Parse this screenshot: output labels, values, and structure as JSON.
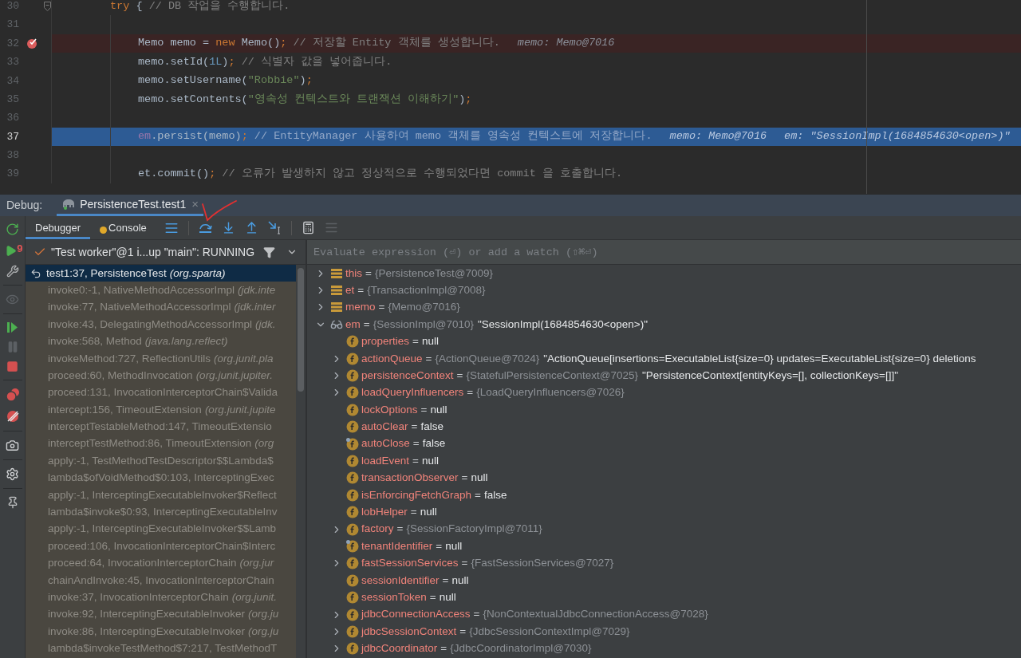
{
  "editor": {
    "lines": [
      {
        "number": "30",
        "nested": false,
        "breakpoint": false,
        "current": false,
        "fold": true,
        "segments": [
          {
            "kind": "keyword",
            "text": "try"
          },
          {
            "kind": "plain",
            "text": " { "
          },
          {
            "kind": "comment",
            "text": "// DB 작업을 수행합니다."
          }
        ]
      },
      {
        "number": "31",
        "nested": true,
        "breakpoint": false,
        "current": false,
        "fold": false
      },
      {
        "number": "32",
        "nested": true,
        "breakpoint": true,
        "current": false,
        "fold": false,
        "segments": [
          {
            "kind": "plain",
            "text": "Memo memo = "
          },
          {
            "kind": "keyword",
            "text": "new"
          },
          {
            "kind": "plain",
            "text": " Memo()"
          },
          {
            "kind": "keyword",
            "text": ";"
          },
          {
            "kind": "comment",
            "text": " // 저장할 Entity 객체를 생성합니다."
          },
          {
            "kind": "hint",
            "text": "memo: Memo@7016"
          }
        ]
      },
      {
        "number": "33",
        "nested": true,
        "breakpoint": false,
        "current": false,
        "fold": false,
        "segments": [
          {
            "kind": "plain",
            "text": "memo.setId("
          },
          {
            "kind": "number",
            "text": "1L"
          },
          {
            "kind": "plain",
            "text": ")"
          },
          {
            "kind": "keyword",
            "text": ";"
          },
          {
            "kind": "comment",
            "text": " // 식별자 값을 넣어줍니다."
          }
        ]
      },
      {
        "number": "34",
        "nested": true,
        "breakpoint": false,
        "current": false,
        "fold": false,
        "segments": [
          {
            "kind": "plain",
            "text": "memo.setUsername("
          },
          {
            "kind": "string",
            "text": "\"Robbie\""
          },
          {
            "kind": "plain",
            "text": ")"
          },
          {
            "kind": "keyword",
            "text": ";"
          }
        ]
      },
      {
        "number": "35",
        "nested": true,
        "breakpoint": false,
        "current": false,
        "fold": false,
        "segments": [
          {
            "kind": "plain",
            "text": "memo.setContents("
          },
          {
            "kind": "string",
            "text": "\"영속성 컨텍스트와 트랜잭션 이해하기\""
          },
          {
            "kind": "plain",
            "text": ")"
          },
          {
            "kind": "keyword",
            "text": ";"
          }
        ]
      },
      {
        "number": "36",
        "nested": true,
        "breakpoint": false,
        "current": false,
        "fold": false
      },
      {
        "number": "37",
        "nested": true,
        "breakpoint": false,
        "current": true,
        "fold": false,
        "segments": [
          {
            "kind": "field",
            "text": "em"
          },
          {
            "kind": "plain",
            "text": ".persist(memo)"
          },
          {
            "kind": "keyword",
            "text": ";"
          },
          {
            "kind": "comment",
            "text": " // EntityManager 사용하여 memo 객체를 영속성 컨텍스트에 저장합니다."
          },
          {
            "kind": "hint",
            "text": "memo: Memo@7016"
          },
          {
            "kind": "hint",
            "text": "em: \"SessionImpl(1684854630<open>)\""
          }
        ]
      },
      {
        "number": "38",
        "nested": true,
        "breakpoint": false,
        "current": false,
        "fold": false
      },
      {
        "number": "39",
        "nested": true,
        "breakpoint": false,
        "current": false,
        "fold": false,
        "segments": [
          {
            "kind": "plain",
            "text": "et.commit()"
          },
          {
            "kind": "keyword",
            "text": ";"
          },
          {
            "kind": "comment",
            "text": " // 오류가 발생하지 않고 정상적으로 수행되었다면 commit 을 호출합니다."
          }
        ]
      }
    ]
  },
  "debug": {
    "label": "Debug:",
    "tab": {
      "title": "PersistenceTest.test1",
      "close": "×"
    },
    "subtabs": [
      {
        "label": "Debugger",
        "selected": true
      },
      {
        "label": "Console",
        "selected": false
      }
    ],
    "breakpoint_count": "9",
    "thread": "\"Test worker\"@1 i...up \"main\": RUNNING",
    "frames": [
      {
        "method": "test1:37, PersistenceTest",
        "package": "(org.sparta)",
        "selected": true
      },
      {
        "method": "invoke0:-1, NativeMethodAccessorImpl",
        "package": "(jdk.inte",
        "selected": false
      },
      {
        "method": "invoke:77, NativeMethodAccessorImpl",
        "package": "(jdk.inter",
        "selected": false
      },
      {
        "method": "invoke:43, DelegatingMethodAccessorImpl",
        "package": "(jdk.",
        "selected": false
      },
      {
        "method": "invoke:568, Method",
        "package": "(java.lang.reflect)",
        "selected": false
      },
      {
        "method": "invokeMethod:727, ReflectionUtils",
        "package": "(org.junit.pla",
        "selected": false
      },
      {
        "method": "proceed:60, MethodInvocation",
        "package": "(org.junit.jupiter.",
        "selected": false
      },
      {
        "method": "proceed:131, InvocationInterceptorChain$Valida",
        "selected": false
      },
      {
        "method": "intercept:156, TimeoutExtension",
        "package": "(org.junit.jupite",
        "selected": false
      },
      {
        "method": "interceptTestableMethod:147, TimeoutExtensio",
        "selected": false
      },
      {
        "method": "interceptTestMethod:86, TimeoutExtension",
        "package": "(org",
        "selected": false
      },
      {
        "method": "apply:-1, TestMethodTestDescriptor$$Lambda$",
        "selected": false
      },
      {
        "method": "lambda$ofVoidMethod$0:103, InterceptingExec",
        "selected": false
      },
      {
        "method": "apply:-1, InterceptingExecutableInvoker$Reflect",
        "selected": false
      },
      {
        "method": "lambda$invoke$0:93, InterceptingExecutableInv",
        "selected": false
      },
      {
        "method": "apply:-1, InterceptingExecutableInvoker$$Lamb",
        "selected": false
      },
      {
        "method": "proceed:106, InvocationInterceptorChain$Interc",
        "selected": false
      },
      {
        "method": "proceed:64, InvocationInterceptorChain",
        "package": "(org.jur",
        "selected": false
      },
      {
        "method": "chainAndInvoke:45, InvocationInterceptorChain",
        "selected": false
      },
      {
        "method": "invoke:37, InvocationInterceptorChain",
        "package": "(org.junit.",
        "selected": false
      },
      {
        "method": "invoke:92, InterceptingExecutableInvoker",
        "package": "(org.ju",
        "selected": false
      },
      {
        "method": "invoke:86, InterceptingExecutableInvoker",
        "package": "(org.ju",
        "selected": false
      },
      {
        "method": "lambda$invokeTestMethod$7:217, TestMethodT",
        "selected": false
      }
    ],
    "evaluate": {
      "placeholder": "Evaluate expression (⏎) or add a watch (⇧⌘⏎)"
    },
    "variables": [
      {
        "name": "this",
        "operator": "=",
        "value": "{PersistenceTest@7009}",
        "kind": "local",
        "dimmed": true,
        "expandable": true,
        "expanded": false
      },
      {
        "name": "et",
        "operator": "=",
        "value": "{TransactionImpl@7008}",
        "kind": "local",
        "dimmed": true,
        "expandable": true,
        "expanded": false
      },
      {
        "name": "memo",
        "operator": "=",
        "value": "{Memo@7016}",
        "kind": "local",
        "dimmed": true,
        "expandable": true,
        "expanded": false
      },
      {
        "name": "em",
        "operator": "=",
        "value": "{SessionImpl@7010}",
        "detail": "\"SessionImpl(1684854630<open>)\"",
        "kind": "watch",
        "dimmed": true,
        "expandable": true,
        "expanded": true,
        "children": [
          {
            "name": "properties",
            "operator": "=",
            "value": "null",
            "kind": "field",
            "dimmed": false,
            "expandable": false,
            "overlay": false
          },
          {
            "name": "actionQueue",
            "operator": "=",
            "value": "{ActionQueue@7024}",
            "detail": "\"ActionQueue[insertions=ExecutableList{size=0} updates=ExecutableList{size=0} deletions",
            "kind": "field",
            "dimmed": true,
            "expandable": true,
            "overlay": false
          },
          {
            "name": "persistenceContext",
            "operator": "=",
            "value": "{StatefulPersistenceContext@7025}",
            "detail": "\"PersistenceContext[entityKeys=[], collectionKeys=[]]\"",
            "kind": "field",
            "dimmed": true,
            "expandable": true,
            "overlay": false
          },
          {
            "name": "loadQueryInfluencers",
            "operator": "=",
            "value": "{LoadQueryInfluencers@7026}",
            "kind": "field",
            "dimmed": true,
            "expandable": true,
            "overlay": false
          },
          {
            "name": "lockOptions",
            "operator": "=",
            "value": "null",
            "kind": "field",
            "dimmed": false,
            "expandable": false,
            "overlay": false
          },
          {
            "name": "autoClear",
            "operator": "=",
            "value": "false",
            "kind": "field",
            "dimmed": false,
            "expandable": false,
            "overlay": false
          },
          {
            "name": "autoClose",
            "operator": "=",
            "value": "false",
            "kind": "field",
            "dimmed": false,
            "expandable": false,
            "overlay": true
          },
          {
            "name": "loadEvent",
            "operator": "=",
            "value": "null",
            "kind": "field",
            "dimmed": false,
            "expandable": false,
            "overlay": false
          },
          {
            "name": "transactionObserver",
            "operator": "=",
            "value": "null",
            "kind": "field",
            "dimmed": false,
            "expandable": false,
            "overlay": false
          },
          {
            "name": "isEnforcingFetchGraph",
            "operator": "=",
            "value": "false",
            "kind": "field",
            "dimmed": false,
            "expandable": false,
            "overlay": false
          },
          {
            "name": "lobHelper",
            "operator": "=",
            "value": "null",
            "kind": "field",
            "dimmed": false,
            "expandable": false,
            "overlay": false
          },
          {
            "name": "factory",
            "operator": "=",
            "value": "{SessionFactoryImpl@7011}",
            "kind": "field",
            "dimmed": true,
            "expandable": true,
            "overlay": false
          },
          {
            "name": "tenantIdentifier",
            "operator": "=",
            "value": "null",
            "kind": "field",
            "dimmed": false,
            "expandable": false,
            "overlay": true
          },
          {
            "name": "fastSessionServices",
            "operator": "=",
            "value": "{FastSessionServices@7027}",
            "kind": "field",
            "dimmed": true,
            "expandable": true,
            "overlay": false
          },
          {
            "name": "sessionIdentifier",
            "operator": "=",
            "value": "null",
            "kind": "field",
            "dimmed": false,
            "expandable": false,
            "overlay": false
          },
          {
            "name": "sessionToken",
            "operator": "=",
            "value": "null",
            "kind": "field",
            "dimmed": false,
            "expandable": false,
            "overlay": false
          },
          {
            "name": "jdbcConnectionAccess",
            "operator": "=",
            "value": "{NonContextualJdbcConnectionAccess@7028}",
            "kind": "field",
            "dimmed": true,
            "expandable": true,
            "overlay": false
          },
          {
            "name": "jdbcSessionContext",
            "operator": "=",
            "value": "{JdbcSessionContextImpl@7029}",
            "kind": "field",
            "dimmed": true,
            "expandable": true,
            "overlay": false
          },
          {
            "name": "jdbcCoordinator",
            "operator": "=",
            "value": "{JdbcCoordinatorImpl@7030}",
            "kind": "field",
            "dimmed": true,
            "expandable": true,
            "overlay": false
          }
        ]
      }
    ]
  }
}
